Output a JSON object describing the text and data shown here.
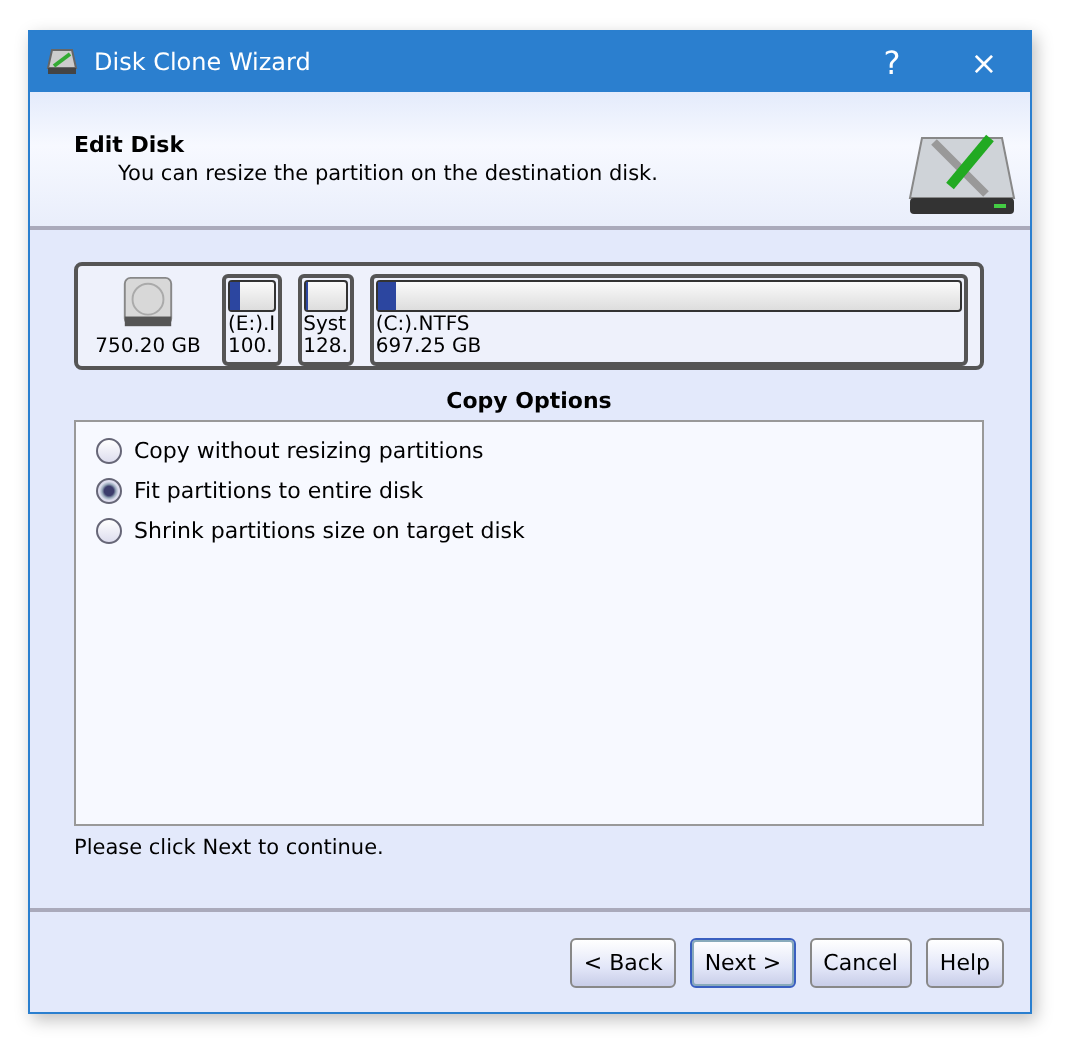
{
  "window": {
    "title": "Disk Clone Wizard",
    "help": "?",
    "close": "×"
  },
  "header": {
    "title": "Edit Disk",
    "subtitle": "You can resize the partition on the destination disk."
  },
  "disk": {
    "size": "750.20 GB",
    "partitions": [
      {
        "name": "(E:).I",
        "size": "100.",
        "level": 0.25,
        "kind": "small"
      },
      {
        "name": "Syst",
        "size": "128.",
        "level": 0.08,
        "kind": "small"
      },
      {
        "name": "(C:).NTFS",
        "size": "697.25 GB",
        "level": 0.03,
        "kind": "wide"
      }
    ]
  },
  "copy_options": {
    "title": "Copy Options",
    "options": [
      {
        "label": "Copy without resizing partitions",
        "selected": false
      },
      {
        "label": "Fit partitions to entire disk",
        "selected": true
      },
      {
        "label": "Shrink partitions size on target disk",
        "selected": false
      }
    ]
  },
  "hint": "Please click Next to continue.",
  "buttons": [
    {
      "label": "< Back",
      "default": false
    },
    {
      "label": "Next >",
      "default": true
    },
    {
      "label": "Cancel",
      "default": false
    },
    {
      "label": "Help",
      "default": false
    }
  ]
}
